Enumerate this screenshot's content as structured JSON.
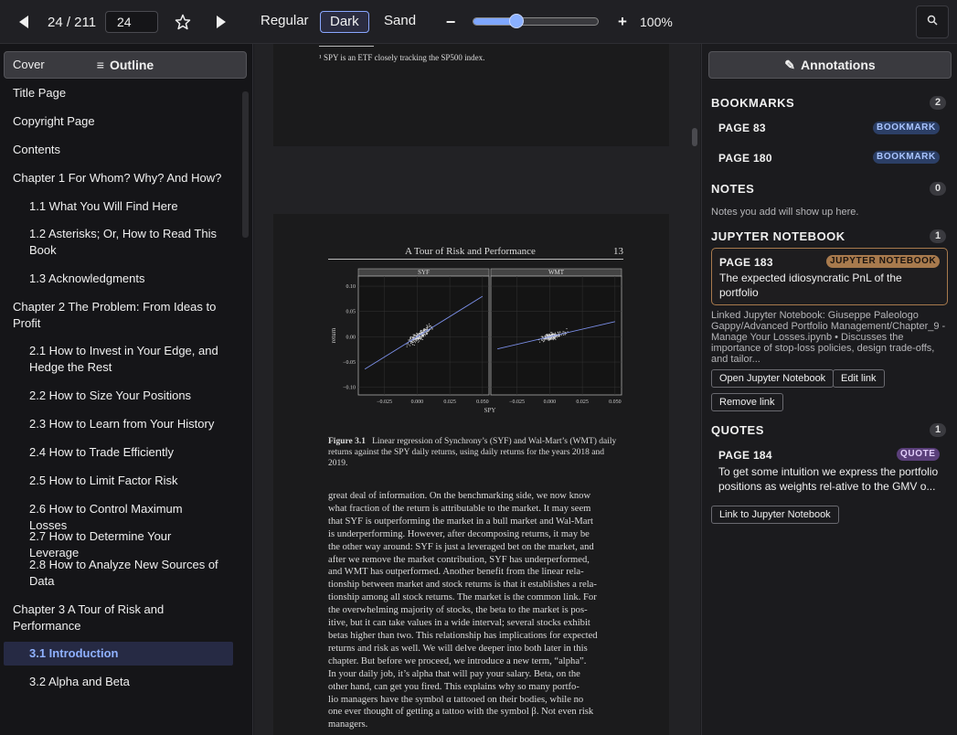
{
  "toolbar": {
    "page_indicator": "24 / 211",
    "page_input_value": "24",
    "themes": [
      "Regular",
      "Dark",
      "Sand"
    ],
    "active_theme": "Dark",
    "zoom_label": "100%",
    "zoom_level": 0.35,
    "accent": "#7fa7ff"
  },
  "sidebar": {
    "outline_label": "Outline",
    "items": [
      {
        "label": "Cover",
        "indent": 0
      },
      {
        "label": "Title Page",
        "indent": 0
      },
      {
        "label": "Copyright Page",
        "indent": 0
      },
      {
        "label": "Contents",
        "indent": 0
      },
      {
        "label": "Chapter 1 For Whom? Why? And How?",
        "indent": 0
      },
      {
        "label": "1.1 What You Will Find Here",
        "indent": 1
      },
      {
        "label": "1.2 Asterisks; Or, How to Read This Book",
        "indent": 1
      },
      {
        "label": "1.3 Acknowledgments",
        "indent": 1
      },
      {
        "label": "Chapter 2 The Problem: From Ideas to Profit",
        "indent": 0
      },
      {
        "label": "2.1 How to Invest in Your Edge, and Hedge the Rest",
        "indent": 1
      },
      {
        "label": "2.2 How to Size Your Positions",
        "indent": 1
      },
      {
        "label": "2.3 How to Learn from Your History",
        "indent": 1
      },
      {
        "label": "2.4 How to Trade Efficiently",
        "indent": 1
      },
      {
        "label": "2.5 How to Limit Factor Risk",
        "indent": 1
      },
      {
        "label": "2.6 How to Control Maximum Losses",
        "indent": 1
      },
      {
        "label": "2.7 How to Determine Your Leverage",
        "indent": 1
      },
      {
        "label": "2.8 How to Analyze New Sources of Data",
        "indent": 1
      },
      {
        "label": "Chapter 3 A Tour of Risk and Performance",
        "indent": 0
      },
      {
        "label": "3.1 Introduction",
        "indent": 1,
        "active": true
      },
      {
        "label": "3.2 Alpha and Beta",
        "indent": 1
      }
    ]
  },
  "document": {
    "footnote": "¹ SPY is an ETF closely tracking the SP500 index.",
    "running_header": "A Tour of Risk and Performance",
    "page_number": "13",
    "figure_caption_label": "Figure 3.1",
    "figure_caption_text": "Linear regression of Synchrony’s (SYF) and Wal-Mart’s (WMT) daily returns against the SPY daily returns, using daily returns for the years 2018 and 2019.",
    "body_lines": [
      "great deal of information. On the benchmarking side, we now know",
      "what fraction of the return is attributable to the market. It may seem",
      "that SYF is outperforming the market in a bull market and Wal-Mart",
      "is underperforming. However, after decomposing returns, it may be",
      "the other way around: SYF is just a leveraged bet on the market, and",
      "after we remove the market contribution, SYF has underperformed,",
      "and WMT has outperformed. Another benefit from the linear rela-",
      "tionship between market and stock returns is that it establishes a rela-",
      "tionship among all stock returns. The market is the common link. For",
      "the overwhelming majority of stocks, the beta to the market is pos-",
      "itive, but it can take values in a wide interval; several stocks exhibit",
      "betas higher than two. This relationship has implications for expected",
      "returns and risk as well. We will delve deeper into both later in this",
      "chapter. But before we proceed, we introduce a new term, “alpha”.",
      "In your daily job, it’s alpha that will pay your salary. Beta, on the",
      "other hand, can get you fired. This explains why so many portfo-",
      "lio managers have the symbol α tattooed on their bodies, while no",
      "one ever thought of getting a tattoo with the symbol β. Not even risk",
      "managers."
    ],
    "figure": {
      "panels": [
        {
          "name": "SYF",
          "slope": 1.6,
          "spread": 0.012
        },
        {
          "name": "WMT",
          "slope": 0.6,
          "spread": 0.008
        }
      ],
      "ylabel": "return",
      "xlabel": "SPY",
      "yticks": [
        "0.10",
        "0.05",
        "0.00",
        "−0.05",
        "−0.10"
      ],
      "ytick_values": [
        0.1,
        0.05,
        0.0,
        -0.05,
        -0.1
      ],
      "xticks": [
        "−0.025",
        "0.000",
        "0.025",
        "0.050"
      ],
      "xtick_values": [
        -0.025,
        0.0,
        0.025,
        0.05
      ]
    }
  },
  "annotations": {
    "title": "Annotations",
    "bookmarks": {
      "heading": "BOOKMARKS",
      "count": "2",
      "items": [
        {
          "page": "PAGE 83",
          "badge": "BOOKMARK"
        },
        {
          "page": "PAGE 180",
          "badge": "BOOKMARK"
        }
      ]
    },
    "notes": {
      "heading": "NOTES",
      "count": "0",
      "empty": "Notes you add will show up here."
    },
    "jupyter": {
      "heading": "JUPYTER NOTEBOOK",
      "count": "1",
      "page": "PAGE 183",
      "badge": "JUPYTER NOTEBOOK",
      "text": "The expected idiosyncratic PnL of the portfolio",
      "linked": "Linked Jupyter Notebook: Giuseppe Paleologo Gappy/Advanced Portfolio Management/Chapter_9 - Manage Your Losses.ipynb • Discusses the importance of stop-loss policies, design trade-offs, and tailor...",
      "open_btn": "Open Jupyter Notebook",
      "edit_btn": "Edit link",
      "remove_btn": "Remove link"
    },
    "quotes": {
      "heading": "QUOTES",
      "count": "1",
      "page": "PAGE 184",
      "badge": "QUOTE",
      "text": "To get some intuition we express the portfolio positions as weights rel-ative to the GMV o...",
      "link_btn": "Link to Jupyter Notebook"
    }
  }
}
